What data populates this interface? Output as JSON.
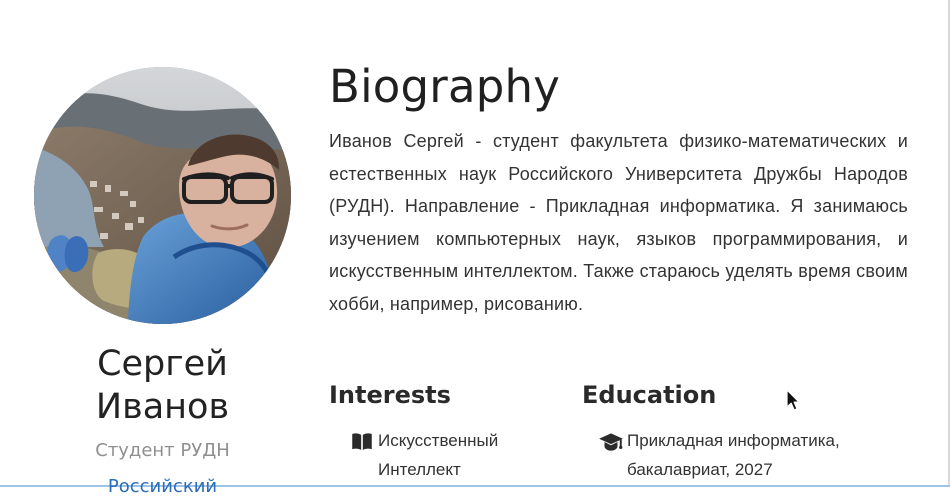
{
  "profile": {
    "name_line1": "Сергей",
    "name_line2": "Иванов",
    "role": "Студент РУДН",
    "university_link": "Российский"
  },
  "biography": {
    "title": "Biography",
    "text": "Иванов Сергей - студент факультета физико-математических и естественных наук Российского Университета Дружбы Народов (РУДН). Направление - Прикладная информатика. Я занимаюсь изучением компьютерных наук, языков программирования, и искусственным интеллектом. Также стараюсь уделять время своим хобби, например, рисованию."
  },
  "interests": {
    "title": "Interests",
    "items": [
      {
        "icon": "book-icon",
        "text": "Искусственный Интеллект"
      }
    ]
  },
  "education": {
    "title": "Education",
    "items": [
      {
        "icon": "graduation-cap-icon",
        "text": "Прикладная информатика, бакалавриат, 2027"
      }
    ]
  },
  "colors": {
    "link": "#2a6cb6",
    "muted_text": "#8f8f8f",
    "heading": "#2a2a2a"
  },
  "icons": {
    "cursor": "mouse-pointer-icon"
  }
}
